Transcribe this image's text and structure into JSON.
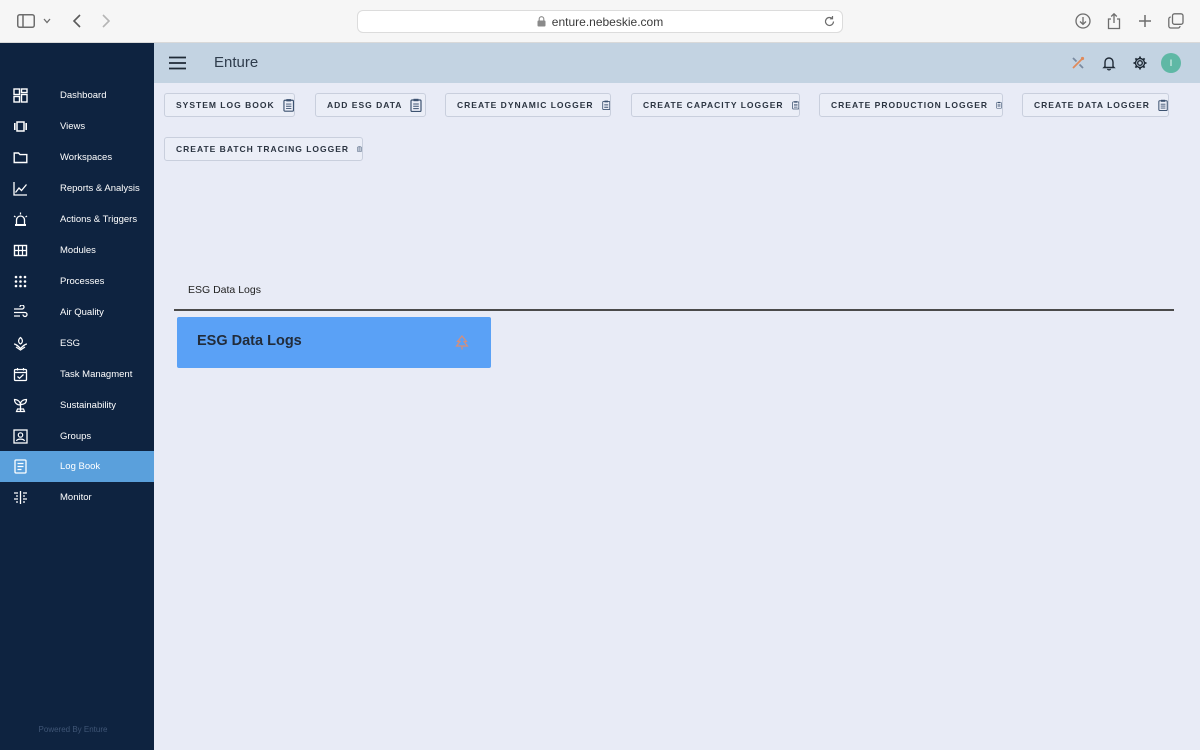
{
  "browser": {
    "url": "enture.nebeskie.com"
  },
  "sidebar": {
    "items": [
      {
        "label": "Dashboard",
        "icon": "dashboard-icon"
      },
      {
        "label": "Views",
        "icon": "views-icon"
      },
      {
        "label": "Workspaces",
        "icon": "folder-icon"
      },
      {
        "label": "Reports & Analysis",
        "icon": "line-chart-icon"
      },
      {
        "label": "Actions & Triggers",
        "icon": "alarm-light-icon"
      },
      {
        "label": "Modules",
        "icon": "grid-icon"
      },
      {
        "label": "Processes",
        "icon": "dots-grid-icon"
      },
      {
        "label": "Air Quality",
        "icon": "wind-icon"
      },
      {
        "label": "ESG",
        "icon": "leaf-hand-icon"
      },
      {
        "label": "Task Managment",
        "icon": "calendar-check-icon"
      },
      {
        "label": "Sustainability",
        "icon": "plant-icon"
      },
      {
        "label": "Groups",
        "icon": "groups-icon"
      },
      {
        "label": "Log Book",
        "icon": "document-icon",
        "active": true
      },
      {
        "label": "Monitor",
        "icon": "monitor-icon"
      }
    ],
    "powered_by": "Powered By Enture"
  },
  "header": {
    "title": "Enture",
    "avatar_initial": "I"
  },
  "toolbar": {
    "buttons": [
      "SYSTEM LOG BOOK",
      "ADD ESG DATA",
      "CREATE DYNAMIC LOGGER",
      "CREATE CAPACITY LOGGER",
      "CREATE PRODUCTION LOGGER",
      "CREATE DATA LOGGER",
      "CREATE BATCH TRACING LOGGER"
    ]
  },
  "main": {
    "tab_label": "ESG Data Logs",
    "card_title": "ESG Data Logs"
  },
  "colors": {
    "sidebar_bg": "#0e2340",
    "active_item": "#5aa0dc",
    "header_bg": "#c3d3e2",
    "card_bg": "#5aa1f6",
    "avatar_bg": "#5fb8a5"
  }
}
